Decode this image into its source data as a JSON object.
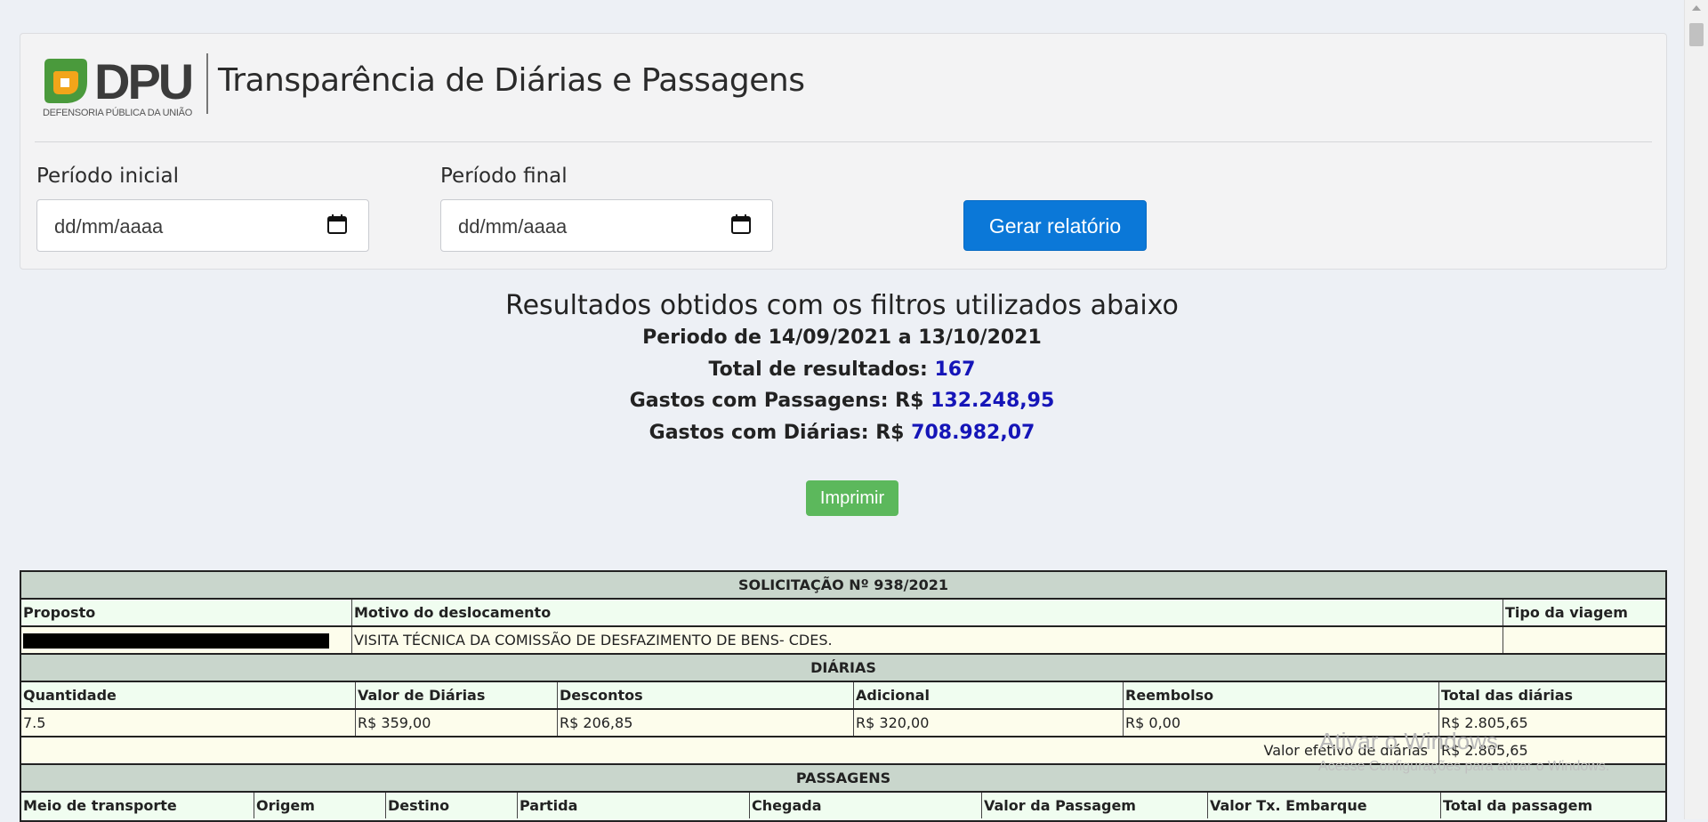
{
  "header": {
    "logo_text": "DPU",
    "logo_subtitle": "DEFENSORIA PÚBLICA DA UNIÃO",
    "title": "Transparência de Diárias e Passagens"
  },
  "filters": {
    "start_label": "Período inicial",
    "start_placeholder": "dd/mm/aaaa",
    "end_label": "Período final",
    "end_placeholder": "dd/mm/aaaa",
    "submit_label": "Gerar relatório"
  },
  "results": {
    "heading": "Resultados obtidos com os filtros utilizados abaixo",
    "period": "Periodo de 14/09/2021 a 13/10/2021",
    "total_label": "Total de resultados:",
    "total_value": "167",
    "tickets_label": "Gastos com Passagens: R$",
    "tickets_value": "132.248,95",
    "per_diem_label": "Gastos com Diárias: R$",
    "per_diem_value": "708.982,07",
    "print_label": "Imprimir"
  },
  "report": {
    "request_title": "SOLICITAÇÃO Nº 938/2021",
    "request_headers": [
      "Proposto",
      "Motivo do deslocamento",
      "Tipo da viagem"
    ],
    "request_row": {
      "motivo": "VISITA TÉCNICA DA COMISSÃO DE DESFAZIMENTO DE BENS- CDES.",
      "tipo": ""
    },
    "per_diem_title": "DIÁRIAS",
    "per_diem_headers": [
      "Quantidade",
      "Valor de Diárias",
      "Descontos",
      "Adicional",
      "Reembolso",
      "Total das diárias"
    ],
    "per_diem_row": [
      "7.5",
      "R$ 359,00",
      "R$ 206,85",
      "R$ 320,00",
      "R$ 0,00",
      "R$ 2.805,65"
    ],
    "effective_label": "Valor efetivo de diárias",
    "effective_value": "R$ 2.805,65",
    "tickets_title": "PASSAGENS",
    "tickets_headers": [
      "Meio de transporte",
      "Origem",
      "Destino",
      "Partida",
      "Chegada",
      "Valor da Passagem",
      "Valor Tx. Embarque",
      "Total da passagem"
    ]
  },
  "watermark": {
    "title": "Ativar o Windows",
    "subtitle": "Acesse Configurações para ativar o Windows."
  }
}
